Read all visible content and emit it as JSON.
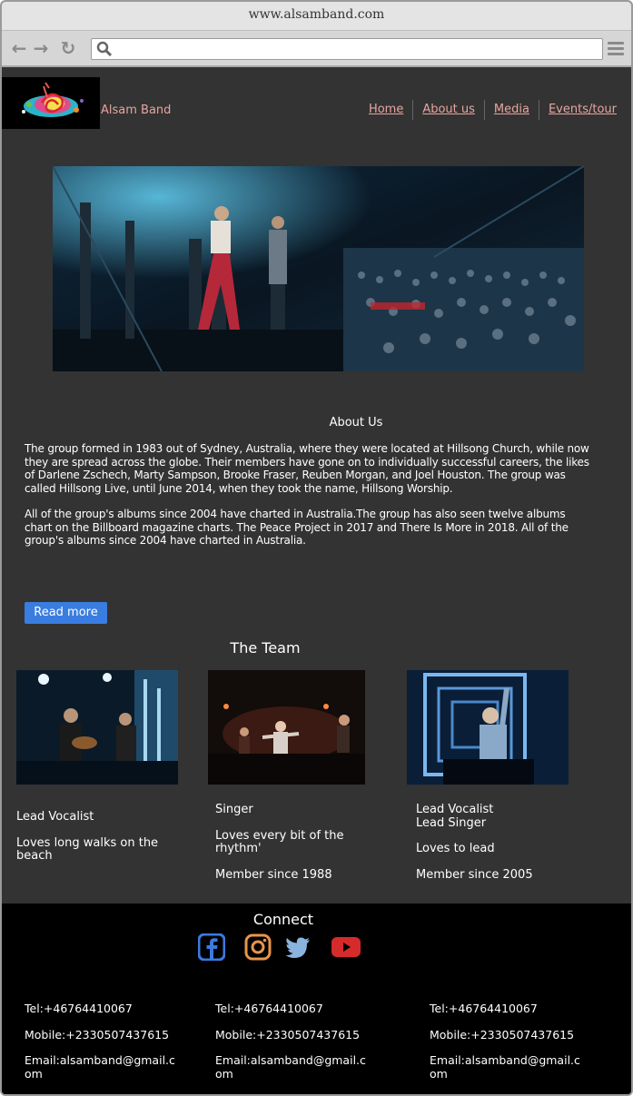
{
  "browser": {
    "url": "www.alsamband.com"
  },
  "header": {
    "brand": "Alsam Band",
    "nav": [
      "Home",
      "About us",
      "Media",
      "Events/tour"
    ]
  },
  "about": {
    "heading": "About Us",
    "para1": "The group formed in 1983 out of Sydney, Australia, where they were located at Hillsong Church, while now they are spread across the globe. Their members have gone on to individually successful careers, the likes of Darlene Zschech, Marty Sampson, Brooke Fraser, Reuben Morgan, and Joel Houston. The group was called Hillsong Live, until June 2014, when they took the name, Hillsong Worship.",
    "para2": "All of the group's albums since 2004 have charted in Australia.The group has also seen twelve albums chart on the Billboard magazine charts. The Peace Project in 2017 and There Is More in 2018. All of the group's albums since 2004 have charted in Australia.",
    "read_more": "Read more"
  },
  "team": {
    "heading": "The Team",
    "members": [
      {
        "role": "Lead Vocalist",
        "desc": "Loves long walks on the beach",
        "since": ""
      },
      {
        "role": "Singer",
        "desc": "Loves every bit of the rhythm'",
        "since": "Member since 1988"
      },
      {
        "role": "Lead Vocalist\n Lead Singer",
        "desc": "Loves to lead",
        "since": "Member since 2005"
      }
    ]
  },
  "footer": {
    "connect": "Connect",
    "social_icons": [
      "facebook-icon",
      "instagram-icon",
      "twitter-icon",
      "youtube-icon"
    ],
    "contacts": [
      {
        "tel": "Tel:+46764410067",
        "mobile": "Mobile:+2330507437615",
        "email": "Email:alsamband@gmail.com"
      },
      {
        "tel": "Tel:+46764410067",
        "mobile": "Mobile:+2330507437615",
        "email": "Email:alsamband@gmail.com"
      },
      {
        "tel": "Tel:+46764410067",
        "mobile": "Mobile:+2330507437615",
        "email": "Email:alsamband@gmail.com"
      }
    ]
  },
  "colors": {
    "background": "#333333",
    "link": "#e8a4a0",
    "button": "#3a7de0",
    "footer": "#000000"
  }
}
